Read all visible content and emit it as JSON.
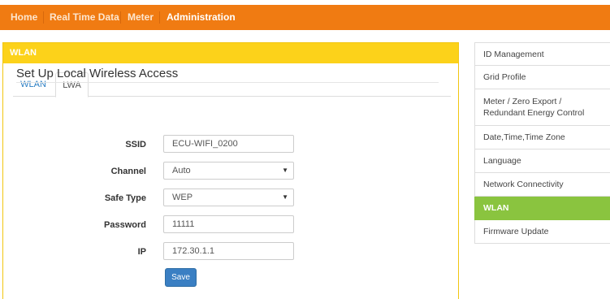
{
  "nav": {
    "items": [
      {
        "label": "Home",
        "active": false
      },
      {
        "label": "Real Time Data",
        "active": false
      },
      {
        "label": "Meter",
        "active": false
      },
      {
        "label": "Administration",
        "active": true
      }
    ]
  },
  "panel": {
    "title": "WLAN",
    "tabs": [
      {
        "label": "WLAN",
        "active": false
      },
      {
        "label": "LWA",
        "active": true
      }
    ],
    "section_title": "Set Up Local Wireless Access",
    "form": {
      "ssid": {
        "label": "SSID",
        "value": "ECU-WIFI_0200"
      },
      "channel": {
        "label": "Channel",
        "value": "Auto"
      },
      "safe_type": {
        "label": "Safe Type",
        "value": "WEP"
      },
      "password": {
        "label": "Password",
        "value": "11111"
      },
      "ip": {
        "label": "IP",
        "value": "172.30.1.1"
      }
    },
    "save_label": "Save"
  },
  "sidebar": {
    "items": [
      {
        "label": "ID Management",
        "active": false
      },
      {
        "label": "Grid Profile",
        "active": false
      },
      {
        "label": "Meter / Zero Export / Redundant Energy Control",
        "active": false
      },
      {
        "label": "Date,Time,Time Zone",
        "active": false
      },
      {
        "label": "Language",
        "active": false
      },
      {
        "label": "Network Connectivity",
        "active": false
      },
      {
        "label": "WLAN",
        "active": true
      },
      {
        "label": "Firmware Update",
        "active": false
      }
    ]
  },
  "colors": {
    "nav_bg": "#f07b12",
    "panel_header": "#fcd21a",
    "active_sidebar": "#8ac43f",
    "button": "#3a7fc3"
  }
}
